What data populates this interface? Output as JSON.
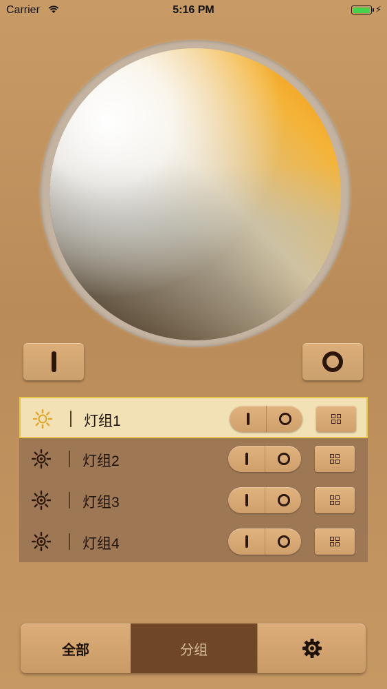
{
  "status_bar": {
    "carrier": "Carrier",
    "time": "5:16 PM",
    "battery_level": 1.0
  },
  "controls": {
    "all_on_icon": "power-on-bar-icon",
    "all_off_icon": "power-off-ring-icon"
  },
  "groups": [
    {
      "name": "灯组1",
      "selected": true
    },
    {
      "name": "灯组2",
      "selected": false
    },
    {
      "name": "灯组3",
      "selected": false
    },
    {
      "name": "灯组4",
      "selected": false
    }
  ],
  "tabs": {
    "all": "全部",
    "group": "分组",
    "settings_icon": "gear-icon",
    "active": "group"
  },
  "colors": {
    "selected_row_bg": "#f1e1b4",
    "active_tab_bg": "#6f4626",
    "list_bg": "#9e7855"
  }
}
